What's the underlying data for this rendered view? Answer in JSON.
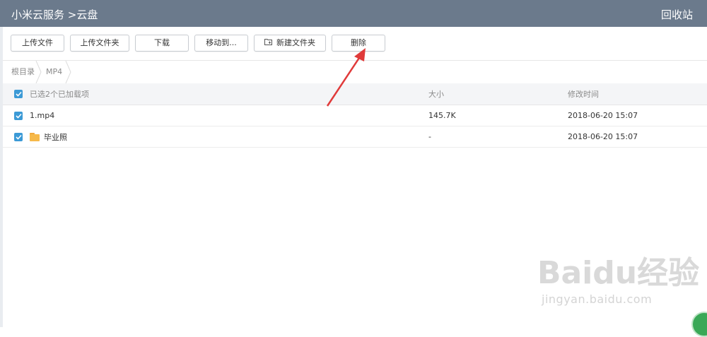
{
  "header": {
    "title": "小米云服务 >云盘",
    "recycle_label": "回收站"
  },
  "toolbar": {
    "upload_file": "上传文件",
    "upload_folder": "上传文件夹",
    "download": "下载",
    "move_to": "移动到...",
    "new_folder": "新建文件夹",
    "delete": "删除"
  },
  "breadcrumb": {
    "root": "根目录",
    "current": "MP4"
  },
  "table": {
    "selection_status": "已选2个已加载项",
    "col_size": "大小",
    "col_modified": "修改时间",
    "rows": [
      {
        "name": "1.mp4",
        "size": "145.7K",
        "modified": "2018-06-20 15:07",
        "type": "file"
      },
      {
        "name": "毕业照",
        "size": "-",
        "modified": "2018-06-20 15:07",
        "type": "folder"
      }
    ]
  },
  "watermark": {
    "logo": "Baidu经验",
    "url": "jingyan.baidu.com"
  },
  "colors": {
    "header_bg": "#6b7a8c",
    "checkbox": "#3c9ad6",
    "folder": "#f6b94a",
    "arrow": "#e03a3a"
  }
}
